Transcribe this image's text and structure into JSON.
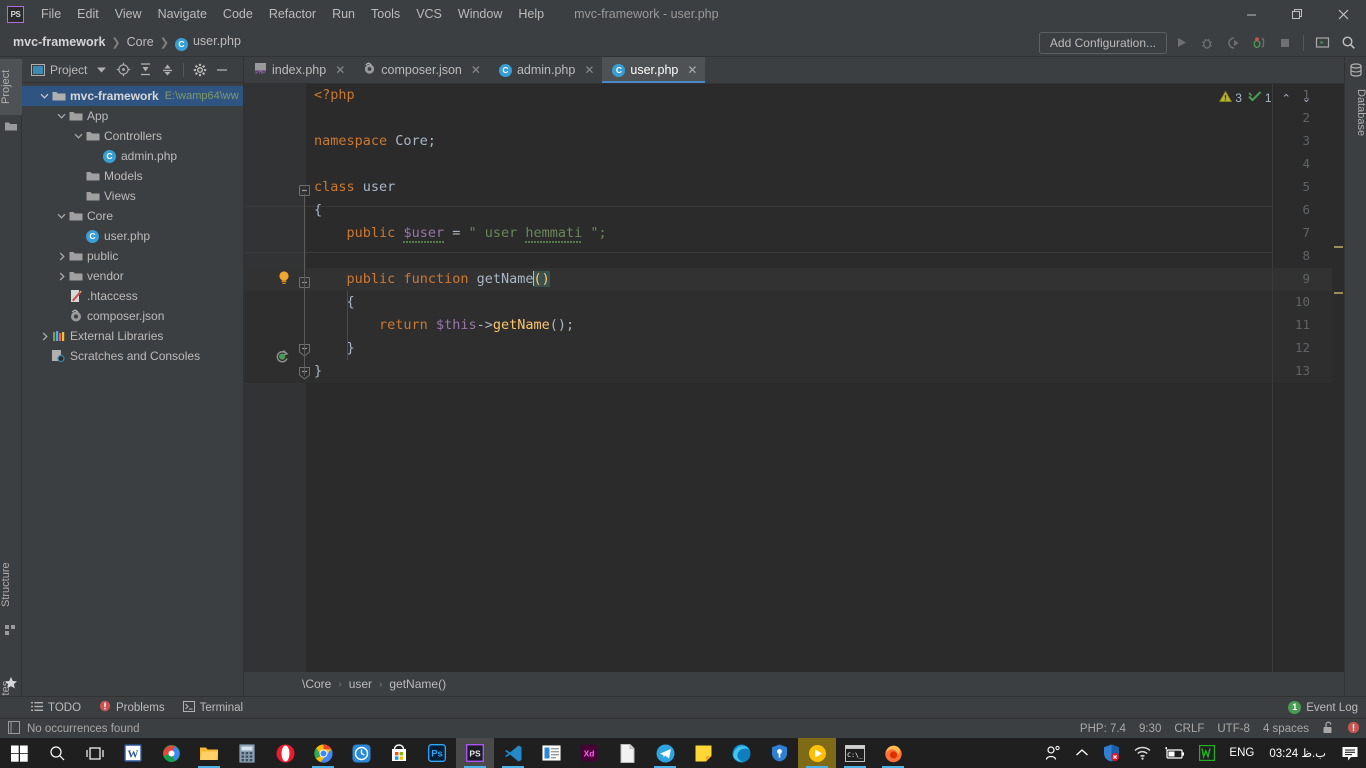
{
  "window": {
    "title": "mvc-framework - user.php",
    "logo_text": "PS",
    "controls": {
      "minimize": "minimize-icon",
      "maximize": "restore-icon",
      "close": "close-icon"
    }
  },
  "menubar": {
    "items": [
      "File",
      "Edit",
      "View",
      "Navigate",
      "Code",
      "Refactor",
      "Run",
      "Tools",
      "VCS",
      "Window",
      "Help"
    ]
  },
  "navbar": {
    "breadcrumbs": [
      {
        "label": "mvc-framework",
        "icon": null,
        "bold": true
      },
      {
        "label": "Core",
        "icon": null,
        "bold": false
      },
      {
        "label": "user.php",
        "icon": "php-class-icon",
        "bold": false
      }
    ],
    "add_configuration": "Add Configuration...",
    "buttons": [
      "run-icon",
      "debug-icon",
      "run-with-coverage-icon",
      "profile-icon",
      "stop-icon",
      "terminal-icon",
      "search-everywhere-icon"
    ]
  },
  "left_strip": {
    "tabs": [
      {
        "label": "Project",
        "active": true
      },
      {
        "label": "Structure",
        "active": false
      },
      {
        "label": "Favorites",
        "active": false
      }
    ]
  },
  "right_strip": {
    "tabs": [
      {
        "label": "Database",
        "active": false
      }
    ]
  },
  "project_panel": {
    "title": "Project",
    "toolbar_icons": [
      "select-opened-file-icon",
      "expand-all-icon",
      "collapse-all-icon",
      "gear-icon",
      "hide-icon"
    ],
    "tree": [
      {
        "label": "mvc-framework",
        "path": "E:\\wamp64\\ww",
        "depth": 0,
        "arrow": "down",
        "icon": "folder-icon",
        "bold": true,
        "selected": true
      },
      {
        "label": "App",
        "depth": 1,
        "arrow": "down",
        "icon": "folder-icon"
      },
      {
        "label": "Controllers",
        "depth": 2,
        "arrow": "down",
        "icon": "folder-icon"
      },
      {
        "label": "admin.php",
        "depth": 3,
        "arrow": "none",
        "icon": "php-class-icon"
      },
      {
        "label": "Models",
        "depth": 2,
        "arrow": "none",
        "icon": "folder-icon"
      },
      {
        "label": "Views",
        "depth": 2,
        "arrow": "none",
        "icon": "folder-icon"
      },
      {
        "label": "Core",
        "depth": 1,
        "arrow": "down",
        "icon": "folder-icon"
      },
      {
        "label": "user.php",
        "depth": 2,
        "arrow": "none",
        "icon": "php-class-icon"
      },
      {
        "label": "public",
        "depth": 1,
        "arrow": "right",
        "icon": "folder-icon"
      },
      {
        "label": "vendor",
        "depth": 1,
        "arrow": "right",
        "icon": "folder-icon"
      },
      {
        "label": ".htaccess",
        "depth": 1,
        "arrow": "none",
        "icon": "htaccess-icon"
      },
      {
        "label": "composer.json",
        "depth": 1,
        "arrow": "none",
        "icon": "composer-icon"
      },
      {
        "label": "External Libraries",
        "depth": 0,
        "arrow": "right",
        "icon": "library-icon"
      },
      {
        "label": "Scratches and Consoles",
        "depth": 0,
        "arrow": "none",
        "icon": "scratches-icon"
      }
    ]
  },
  "editor": {
    "tabs": [
      {
        "label": "index.php",
        "icon": "php-file-icon",
        "active": false
      },
      {
        "label": "composer.json",
        "icon": "composer-icon",
        "active": false
      },
      {
        "label": "admin.php",
        "icon": "php-class-icon",
        "active": false
      },
      {
        "label": "user.php",
        "icon": "php-class-icon",
        "active": true
      }
    ],
    "close_glyph": "✕",
    "inspection": {
      "warning_count": "3",
      "ok_count": "1",
      "up_glyph": "⌃",
      "down_glyph": "⌄"
    },
    "line_numbers": [
      "1",
      "2",
      "3",
      "4",
      "5",
      "6",
      "7",
      "8",
      "9",
      "10",
      "11",
      "12",
      "13"
    ],
    "code": {
      "l1_php_open": "<?php",
      "l3_namespace_kw": "namespace",
      "l3_namespace_name": " Core;",
      "l5_class_kw": "class",
      "l5_class_name": " user",
      "l6_brace": "{",
      "l7_public": "public",
      "l7_var": "$user",
      "l7_eq": " = ",
      "l7_quote_open": "\" user ",
      "l7_word": "hemmati",
      "l7_quote_close": " \";",
      "l9_public": "public",
      "l9_function": "function",
      "l9_name": "getName",
      "l9_parens": "()",
      "l10_brace": "{",
      "l11_return": "return",
      "l11_this": " $this",
      "l11_arrow": "->",
      "l11_call": "getName",
      "l11_tail": "();",
      "l12_brace": "}",
      "l13_brace": "}"
    },
    "breadcrumb": [
      "\\Core",
      "user",
      "getName()"
    ],
    "breadcrumb_sep": "›"
  },
  "bottom_toolwindows": {
    "items": [
      {
        "label": "TODO",
        "icon": "todo-icon"
      },
      {
        "label": "Problems",
        "icon": "problems-icon"
      },
      {
        "label": "Terminal",
        "icon": "terminal-icon"
      }
    ],
    "event_log": {
      "label": "Event Log",
      "count": "1"
    }
  },
  "statusbar": {
    "message": "No occurrences found",
    "message_icon": "document-icon",
    "right_items": [
      "PHP: 7.4",
      "9:30",
      "CRLF",
      "UTF-8",
      "4 spaces"
    ],
    "lock_icon": "unlock-icon",
    "error_icon": "error-icon"
  },
  "taskbar": {
    "items": [
      {
        "name": "start-button",
        "glyph": "windows-logo-icon",
        "running": false
      },
      {
        "name": "search-icon",
        "glyph": "search-icon",
        "running": false
      },
      {
        "name": "task-view-icon",
        "glyph": "task-view-icon",
        "running": false
      },
      {
        "name": "word-icon",
        "glyph": "W",
        "running": false
      },
      {
        "name": "internet-download-manager-icon",
        "glyph": "idm",
        "running": false
      },
      {
        "name": "file-explorer-icon",
        "glyph": "folder",
        "running": true
      },
      {
        "name": "calculator-icon",
        "glyph": "calc",
        "running": false
      },
      {
        "name": "opera-icon",
        "glyph": "O",
        "running": false
      },
      {
        "name": "chrome-icon",
        "glyph": "chrome",
        "running": true
      },
      {
        "name": "clock-app-icon",
        "glyph": "clock",
        "running": false
      },
      {
        "name": "microsoft-store-icon",
        "glyph": "store",
        "running": false
      },
      {
        "name": "photoshop-icon",
        "glyph": "Ps",
        "running": false
      },
      {
        "name": "phpstorm-icon",
        "glyph": "PS",
        "running": true,
        "active": true
      },
      {
        "name": "vscode-icon",
        "glyph": "vs",
        "running": true
      },
      {
        "name": "notes-app-icon",
        "glyph": "notes",
        "running": false
      },
      {
        "name": "adobe-xd-icon",
        "glyph": "Xd",
        "running": false
      },
      {
        "name": "document-icon",
        "glyph": "doc",
        "running": false
      },
      {
        "name": "telegram-icon",
        "glyph": "tg",
        "running": true
      },
      {
        "name": "sticky-notes-icon",
        "glyph": "note",
        "running": false
      },
      {
        "name": "edge-icon",
        "glyph": "edge",
        "running": false
      },
      {
        "name": "shield-vpn-icon",
        "glyph": "shield",
        "running": false
      },
      {
        "name": "media-player-icon",
        "glyph": "play",
        "running": true,
        "active_gold": true
      },
      {
        "name": "command-prompt-icon",
        "glyph": "C:\\",
        "running": true
      },
      {
        "name": "firefox-icon",
        "glyph": "ff",
        "running": true
      }
    ],
    "tray": {
      "people_icon": "people-icon",
      "chevron_icon": "show-hidden-icons-icon",
      "security_icon": "windows-security-icon",
      "wifi_icon": "wifi-icon",
      "battery_icon": "battery-icon",
      "wamp_icon": "wampserver-icon",
      "language": "ENG",
      "clock": "03:24 ب.ظ",
      "notifications_icon": "notifications-icon"
    }
  },
  "colors": {
    "bg_chrome": "#3c3f41",
    "bg_editor": "#2b2b2b",
    "bg_gutter": "#313335",
    "accent_blue": "#4a88c7",
    "selection_blue": "#2f5482",
    "keyword_orange": "#cc7832",
    "string_green": "#6a8759",
    "variable_purple": "#9876aa",
    "function_yellow": "#ffc66d",
    "text_default": "#a9b7c6"
  }
}
